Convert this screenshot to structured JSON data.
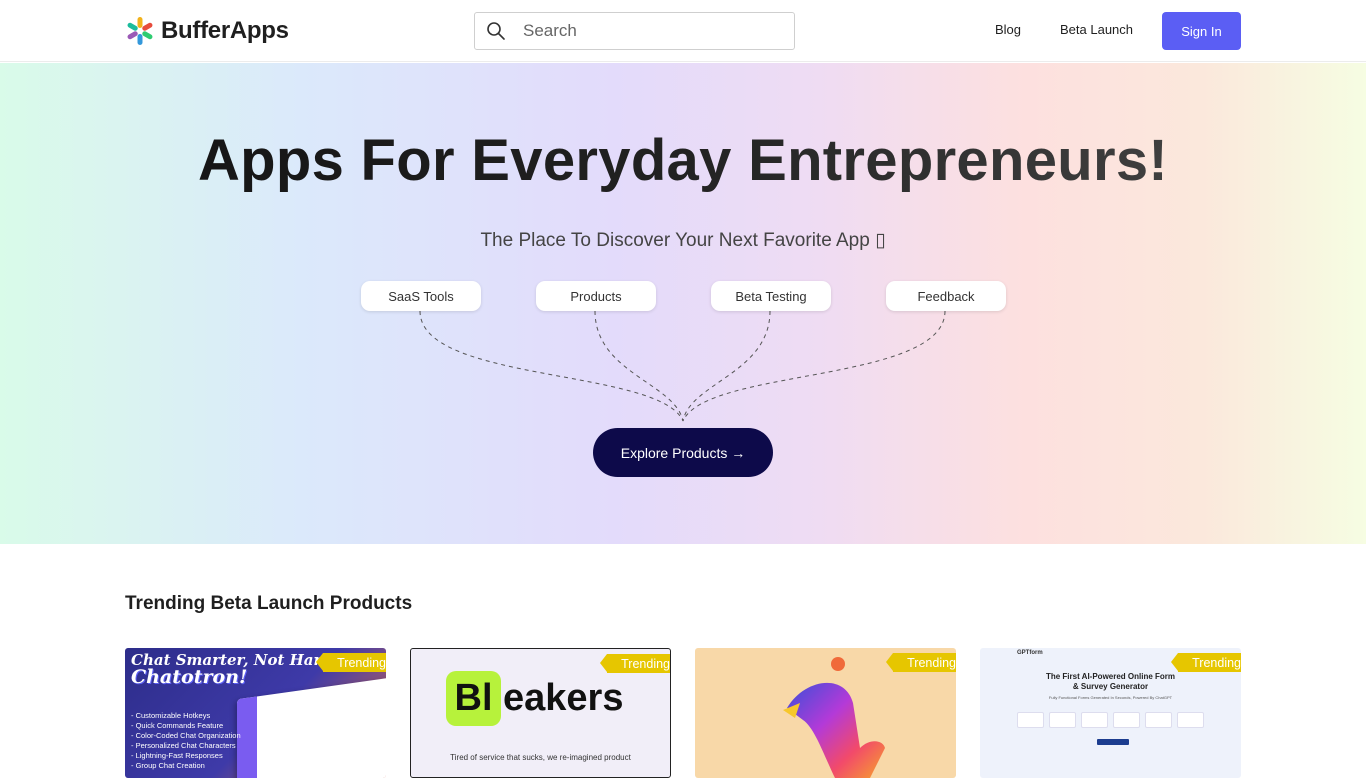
{
  "header": {
    "brand": "BufferApps",
    "search_placeholder": "Search",
    "nav": [
      "Blog",
      "Beta Launch"
    ],
    "signin_label": "Sign In",
    "accent_color": "#5b5ef4"
  },
  "hero": {
    "title": "Apps For Everyday Entrepreneurs!",
    "subtitle": "The Place To Discover Your Next Favorite App ▯",
    "pills": [
      "SaaS Tools",
      "Products",
      "Beta Testing",
      "Feedback"
    ],
    "cta_label": "Explore Products →",
    "cta_color": "#0d0a4a"
  },
  "trending": {
    "title": "Trending Beta Launch Products",
    "badge_label": "Trending",
    "badge_color": "#e6c600",
    "cards": [
      {
        "headline": "Chat Smarter, Not Harder with",
        "name": "Chatotron!",
        "features": [
          "- Customizable Hotkeys",
          "- Quick Commands Feature",
          "- Color-Coded Chat Organization",
          "- Personalized Chat Characters",
          "- Lightning-Fast Responses",
          "- Group Chat Creation"
        ]
      },
      {
        "logo_box": "Bl",
        "logo_rest": "eakers",
        "tagline": "Tired of service that sucks, we re-imagined product"
      },
      {
        "logo_icon": "colorful-bird-logo"
      },
      {
        "brand": "GPTform",
        "title_line1": "The First AI-Powered Online Form",
        "title_line2": "& Survey Generator",
        "subtitle": "Fully Functional Forms Generated In Seconds, Powered By ChatGPT"
      }
    ]
  }
}
